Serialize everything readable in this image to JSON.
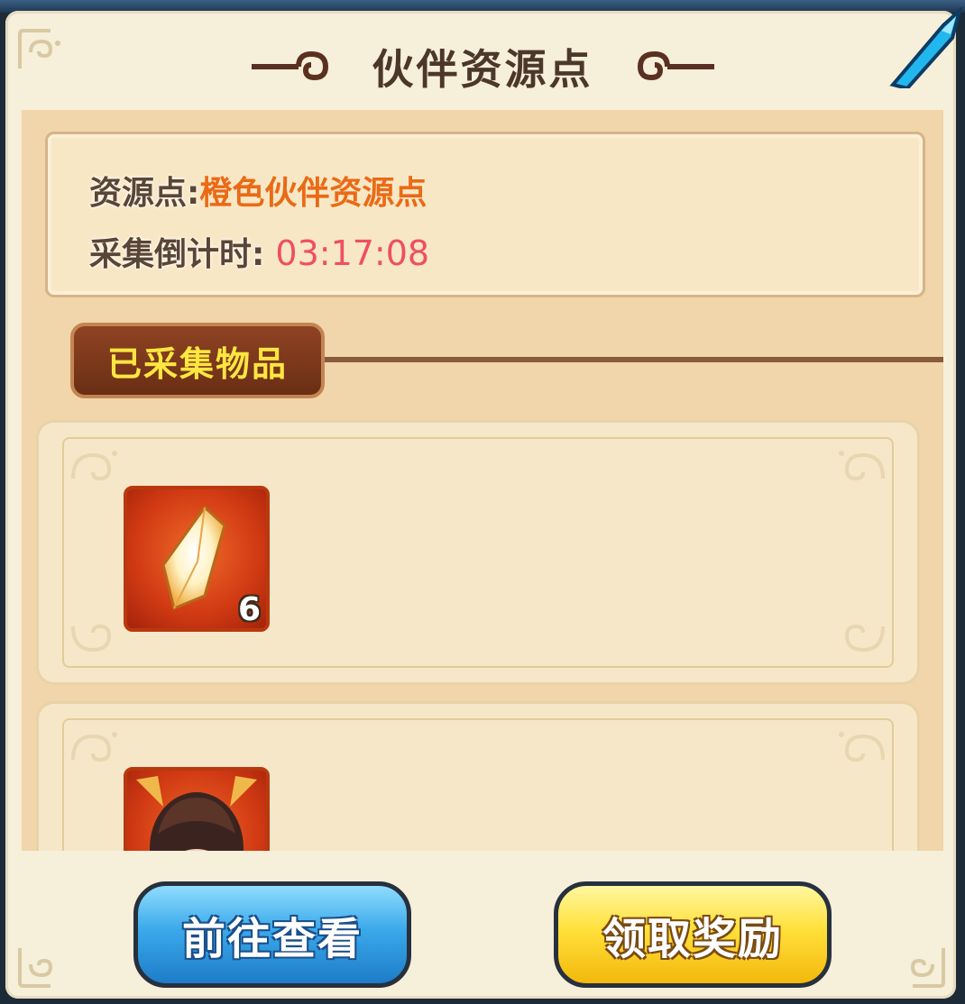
{
  "title": "伙伴资源点",
  "info": {
    "resource_label": "资源点:",
    "resource_value": "橙色伙伴资源点",
    "countdown_label": "采集倒计时:",
    "countdown_value": "03:17:08"
  },
  "collected_section": {
    "label": "已采集物品",
    "items": [
      {
        "icon": "orange-crystal-shard-icon",
        "count": "6"
      },
      {
        "icon": "partner-portrait-icon",
        "count": ""
      }
    ]
  },
  "buttons": {
    "view_label": "前往查看",
    "claim_label": "领取奖励"
  },
  "colors": {
    "panel_bg": "#f6efd9",
    "title_text": "#4c3828",
    "resource_value": "#ea6a16",
    "countdown_value": "#ef4f61",
    "section_label": "#ffe640",
    "view_button": "#3ba9ea",
    "claim_button": "#ffe03a"
  }
}
